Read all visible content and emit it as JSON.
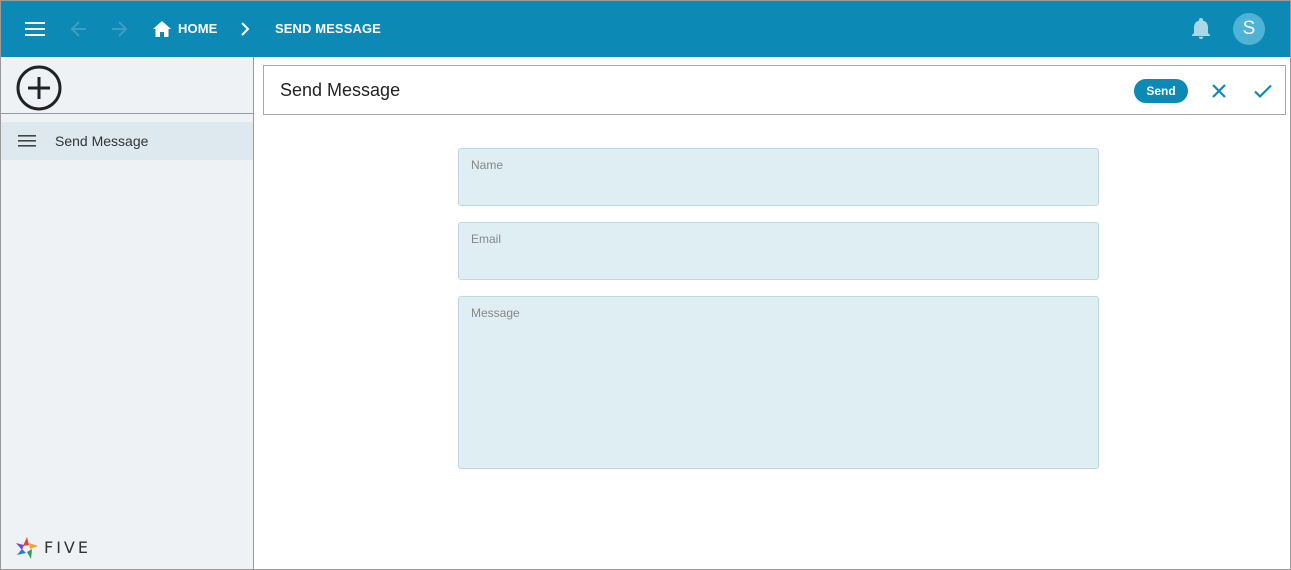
{
  "topbar": {
    "breadcrumb": {
      "home": "HOME",
      "current": "SEND MESSAGE"
    },
    "avatar_initial": "S",
    "icons": {
      "menu": "menu-icon",
      "back": "arrow-left-icon",
      "forward": "arrow-right-icon",
      "home": "home-icon",
      "separator": "chevron-right-icon",
      "notifications": "bell-icon"
    }
  },
  "sidebar": {
    "add_icon": "plus-circle-icon",
    "items": [
      {
        "label": "Send Message",
        "icon": "list-icon"
      }
    ],
    "logo_text": "FIVE"
  },
  "form": {
    "title": "Send Message",
    "send_label": "Send",
    "cancel_icon": "close-icon",
    "confirm_icon": "check-icon",
    "fields": {
      "name": {
        "label": "Name",
        "value": ""
      },
      "email": {
        "label": "Email",
        "value": ""
      },
      "message": {
        "label": "Message",
        "value": ""
      }
    }
  },
  "colors": {
    "brand": "#0c89b5",
    "field_bg": "#deeef3",
    "sidebar_bg": "#eef2f4"
  }
}
